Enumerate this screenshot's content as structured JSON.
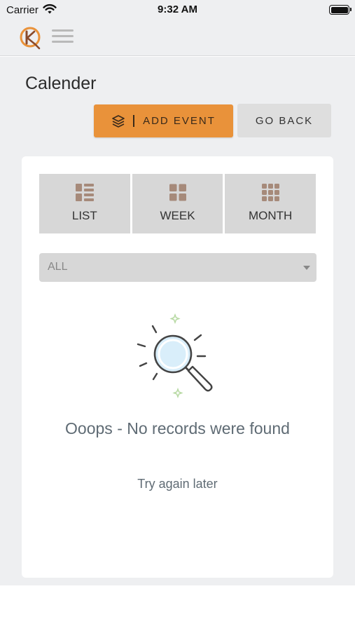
{
  "status_bar": {
    "carrier": "Carrier",
    "time": "9:32 AM"
  },
  "header": {
    "logo_icon": "logo-icon",
    "menu_icon": "hamburger-icon"
  },
  "page": {
    "title": "Calender"
  },
  "actions": {
    "add_event_label": "ADD EVENT",
    "add_event_icon": "layers-icon",
    "go_back_label": "GO BACK"
  },
  "view_tabs": [
    {
      "label": "LIST",
      "icon": "list-view-icon"
    },
    {
      "label": "WEEK",
      "icon": "week-view-icon"
    },
    {
      "label": "MONTH",
      "icon": "month-view-icon"
    }
  ],
  "filter": {
    "selected": "ALL"
  },
  "empty_state": {
    "icon": "magnifier-icon",
    "title": "Ooops - No records were found",
    "subtitle": "Try again later"
  },
  "colors": {
    "accent": "#e9923a",
    "icon_tint": "#a68a7a",
    "background": "#eeeff1"
  }
}
